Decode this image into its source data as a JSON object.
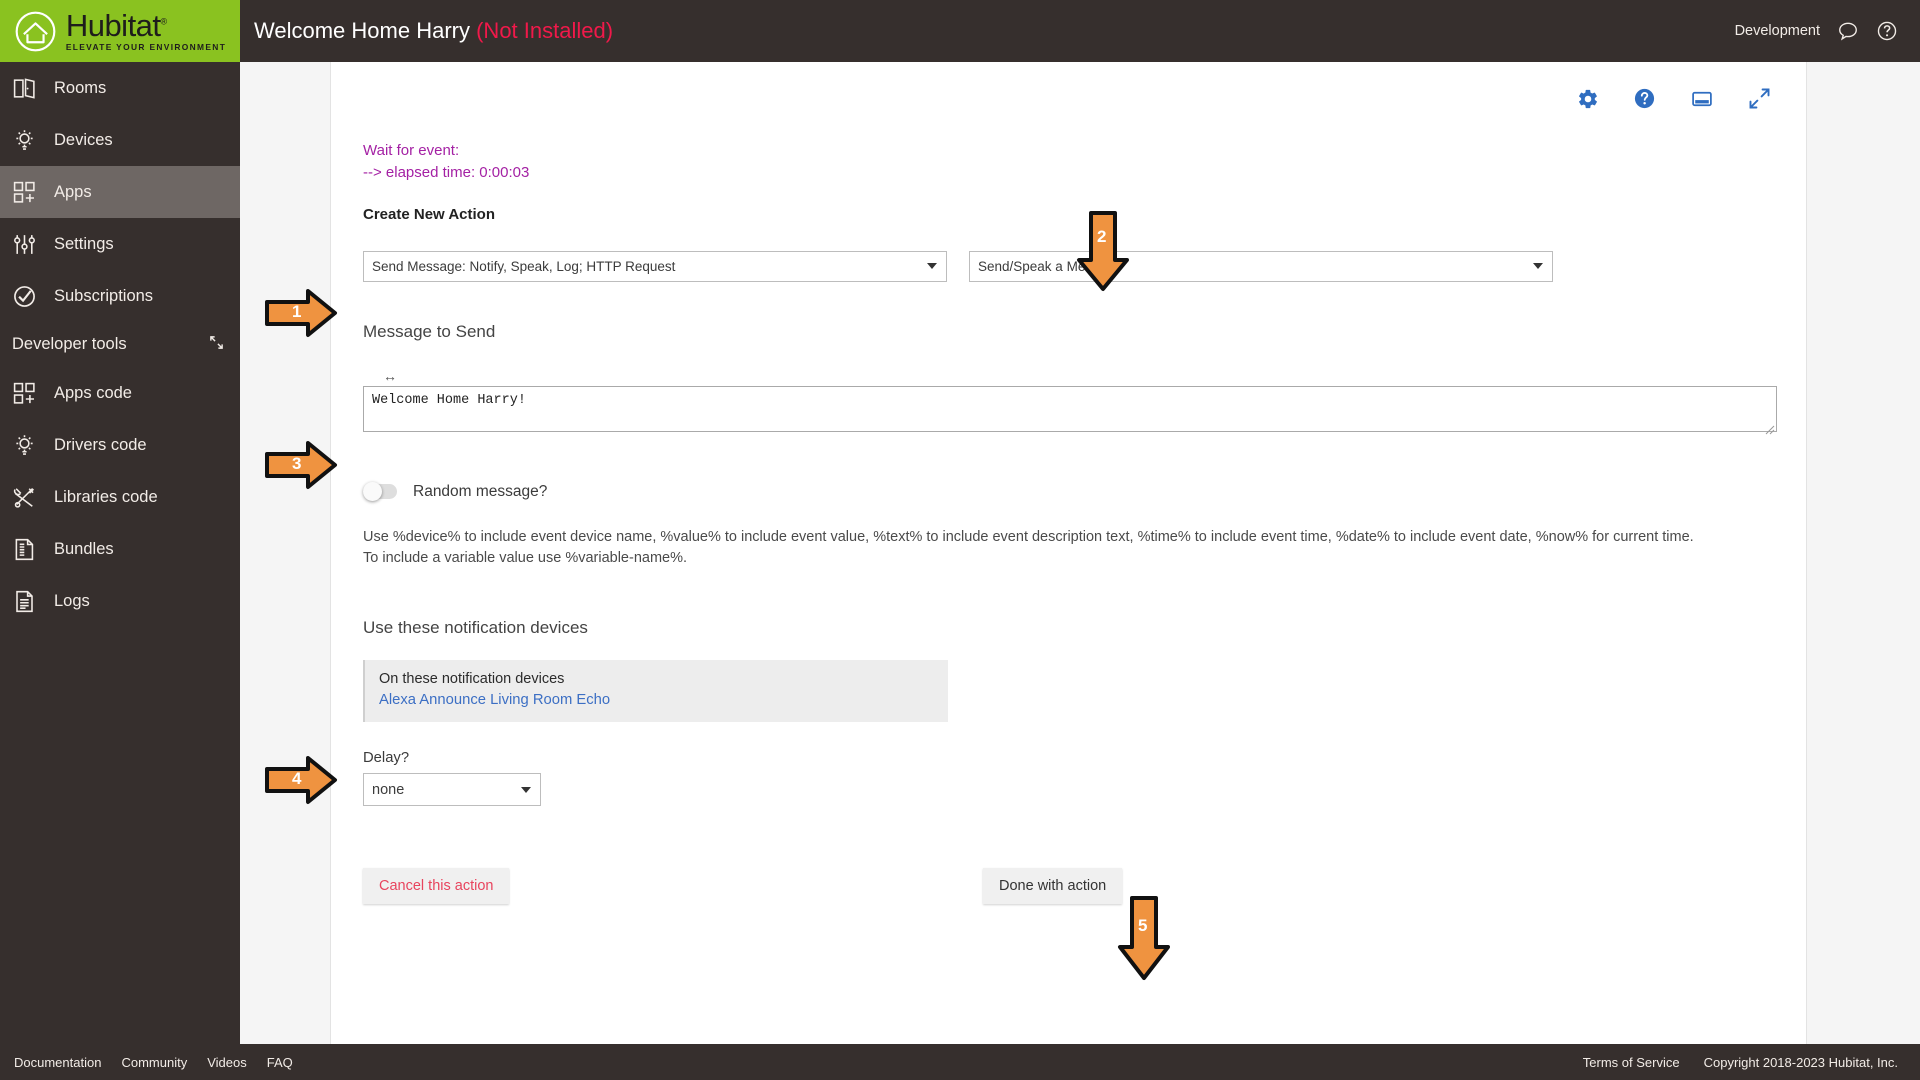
{
  "brand": {
    "name": "Hubitat",
    "registered": "®",
    "tagline": "ELEVATE YOUR ENVIRONMENT",
    "green": "#8ac220",
    "dark": "#362f2d"
  },
  "sidebar": {
    "items": [
      {
        "label": "Rooms",
        "icon": "rooms-icon",
        "active": false
      },
      {
        "label": "Devices",
        "icon": "devices-icon",
        "active": false
      },
      {
        "label": "Apps",
        "icon": "apps-icon",
        "active": true
      },
      {
        "label": "Settings",
        "icon": "settings-icon",
        "active": false
      },
      {
        "label": "Subscriptions",
        "icon": "subscriptions-icon",
        "active": false
      }
    ],
    "section": {
      "label": "Developer tools",
      "collapse_icon": "collapse-icon",
      "items": [
        {
          "label": "Apps code",
          "icon": "apps-code-icon"
        },
        {
          "label": "Drivers code",
          "icon": "drivers-code-icon"
        },
        {
          "label": "Libraries code",
          "icon": "libraries-code-icon"
        },
        {
          "label": "Bundles",
          "icon": "bundles-icon"
        },
        {
          "label": "Logs",
          "icon": "logs-icon"
        }
      ]
    }
  },
  "topbar": {
    "title": "Welcome Home Harry",
    "state": "(Not Installed)",
    "state_color": "#f0194a",
    "environment": "Development",
    "icons": [
      {
        "name": "chat-icon"
      },
      {
        "name": "help-circle-icon"
      }
    ]
  },
  "card": {
    "toolbar_icons": [
      {
        "name": "gear-icon"
      },
      {
        "name": "help-circle-icon"
      },
      {
        "name": "display-icon"
      },
      {
        "name": "expand-icon"
      }
    ],
    "accent": "#2f6dc0"
  },
  "main": {
    "wait_line1": "Wait for event:",
    "wait_line2": "--> elapsed time: 0:00:03",
    "wait_color": "#a421a4",
    "create_new_action": "Create New Action",
    "action_type_select": "Send Message: Notify, Speak, Log; HTTP Request",
    "action_sub_select": "Send/Speak a Message",
    "message_heading": "Message to Send",
    "resize_glyph": "↔",
    "message_value": "Welcome Home Harry!",
    "random_toggle_label": "Random message?",
    "random_toggle_state": "off",
    "help_line1": "Use %device% to include event device name, %value% to include event value, %text% to include event description text, %time% to include event time, %date% to include event date, %now% for current time.",
    "help_line2": "To include a variable value use %variable-name%.",
    "devices_heading": "Use these notification devices",
    "device_box_title": "On these notification devices",
    "device_link": "Alexa Announce Living Room Echo",
    "delay_label": "Delay?",
    "delay_value": "none",
    "cancel_button": "Cancel this action",
    "done_button": "Done with action"
  },
  "annotations": {
    "color": "#ef9340",
    "arrows": [
      {
        "num": "1",
        "direction": "right",
        "target": "action-type-select"
      },
      {
        "num": "2",
        "direction": "down",
        "target": "action-sub-select"
      },
      {
        "num": "3",
        "direction": "right",
        "target": "message-textarea"
      },
      {
        "num": "4",
        "direction": "right",
        "target": "notification-device-box"
      },
      {
        "num": "5",
        "direction": "down",
        "target": "done-with-action-button"
      }
    ]
  },
  "footer": {
    "links": [
      "Documentation",
      "Community",
      "Videos",
      "FAQ"
    ],
    "terms": "Terms of Service",
    "copyright": "Copyright 2018-2023 Hubitat, Inc."
  }
}
